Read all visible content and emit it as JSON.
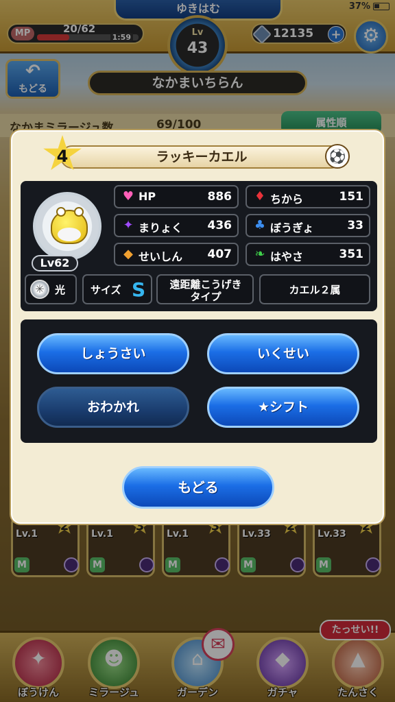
{
  "status": {
    "battery": "37%"
  },
  "header": {
    "player_name": "ゆきはむ",
    "mp_label": "MP",
    "mp_value": "20/62",
    "mp_fraction": 0.32,
    "mp_timer": "1:59",
    "lv_label": "Lv",
    "lv_value": "43",
    "gems": "12135",
    "gem_plus": "+"
  },
  "nav": {
    "back_label": "もどる",
    "title": "なかまいちらん",
    "count_label": "なかまミラージュ数",
    "count_value": "69/100",
    "sort_label": "属性順"
  },
  "bg_cards": [
    {
      "level": "Lv.1",
      "star": "2"
    },
    {
      "level": "Lv.1",
      "star": "3"
    },
    {
      "level": "Lv.1",
      "star": "3"
    },
    {
      "level": "Lv.33",
      "star": "2"
    },
    {
      "level": "Lv.33",
      "star": "2"
    }
  ],
  "bg_badge": "M",
  "modal": {
    "rank": "4",
    "name": "ラッキーカエル",
    "level": "Lv62",
    "stats": [
      {
        "icon": "heart-icon",
        "name": "HP",
        "value": "886",
        "color": "#ff5fb8"
      },
      {
        "icon": "flame-icon",
        "name": "ちから",
        "value": "151",
        "color": "#e8323a"
      },
      {
        "icon": "magic-star-icon",
        "name": "まりょく",
        "value": "436",
        "color": "#a04bff"
      },
      {
        "icon": "shell-icon",
        "name": "ぼうぎょ",
        "value": "33",
        "color": "#3c8ef0"
      },
      {
        "icon": "spirit-icon",
        "name": "せいしん",
        "value": "407",
        "color": "#f0a030"
      },
      {
        "icon": "wing-icon",
        "name": "はやさ",
        "value": "351",
        "color": "#3fcf4a"
      }
    ],
    "attribute": "光",
    "size_label": "サイズ",
    "size_value": "S",
    "type_line1": "遠距離こうげき",
    "type_line2": "タイプ",
    "tribe": "カエル２属",
    "actions": {
      "detail": "しょうさい",
      "train": "いくせい",
      "farewell": "おわかれ",
      "shift": "★シフト"
    },
    "back": "もどる"
  },
  "bottom_nav": {
    "items": [
      "ぼうけん",
      "ミラージュ",
      "ガーデン",
      "ガチャ",
      "たんさく"
    ],
    "achievement_badge": "たっせい!!"
  }
}
